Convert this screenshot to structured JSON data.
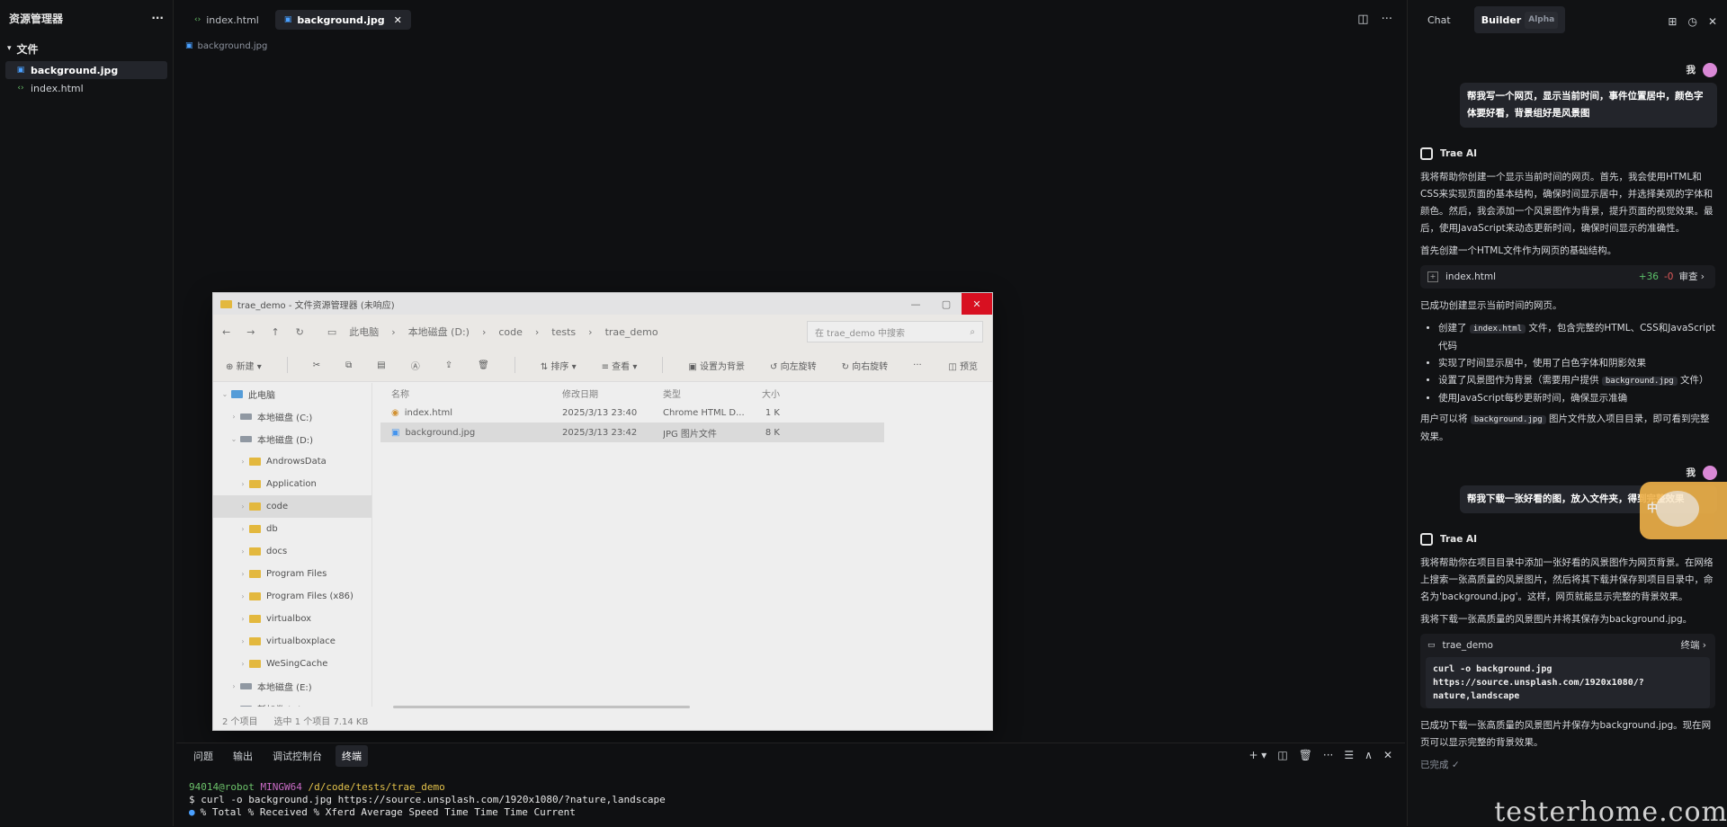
{
  "explorer": {
    "title": "资源管理器",
    "more": "···",
    "section": "文件",
    "files": [
      {
        "name": "background.jpg",
        "icon": "image-icon",
        "active": true
      },
      {
        "name": "index.html",
        "icon": "code-icon",
        "active": false
      }
    ]
  },
  "editor": {
    "tabs": [
      {
        "label": "index.html",
        "active": false
      },
      {
        "label": "background.jpg",
        "active": true
      }
    ],
    "breadcrumb": "background.jpg"
  },
  "winexplorer": {
    "title": "trae_demo - 文件资源管理器 (未响应)",
    "path": [
      "此电脑",
      "本地磁盘 (D:)",
      "code",
      "tests",
      "trae_demo"
    ],
    "search_placeholder": "在 trae_demo 中搜索",
    "toolbar": [
      "新建",
      "排序",
      "查看",
      "设置为背景",
      "向左旋转",
      "向右旋转",
      "···"
    ],
    "preview": "预览",
    "nav": [
      {
        "label": "此电脑",
        "type": "pc",
        "indent": 0,
        "selected": false
      },
      {
        "label": "本地磁盘 (C:)",
        "type": "drive",
        "indent": 1,
        "selected": false
      },
      {
        "label": "本地磁盘 (D:)",
        "type": "drive",
        "indent": 1,
        "selected": false
      },
      {
        "label": "AndrowsData",
        "type": "folder",
        "indent": 2,
        "selected": false
      },
      {
        "label": "Application",
        "type": "folder",
        "indent": 2,
        "selected": false
      },
      {
        "label": "code",
        "type": "folder",
        "indent": 2,
        "selected": true
      },
      {
        "label": "db",
        "type": "folder",
        "indent": 2,
        "selected": false
      },
      {
        "label": "docs",
        "type": "folder",
        "indent": 2,
        "selected": false
      },
      {
        "label": "Program Files",
        "type": "folder",
        "indent": 2,
        "selected": false
      },
      {
        "label": "Program Files (x86)",
        "type": "folder",
        "indent": 2,
        "selected": false
      },
      {
        "label": "virtualbox",
        "type": "folder",
        "indent": 2,
        "selected": false
      },
      {
        "label": "virtualboxplace",
        "type": "folder",
        "indent": 2,
        "selected": false
      },
      {
        "label": "WeSingCache",
        "type": "folder",
        "indent": 2,
        "selected": false
      },
      {
        "label": "本地磁盘 (E:)",
        "type": "drive",
        "indent": 1,
        "selected": false
      },
      {
        "label": "新加卷 (F:)",
        "type": "drive",
        "indent": 1,
        "selected": false
      }
    ],
    "columns": [
      "名称",
      "修改日期",
      "类型",
      "大小"
    ],
    "rows": [
      {
        "name": "index.html",
        "date": "2025/3/13 23:40",
        "type": "Chrome HTML D...",
        "size": "1 K",
        "selected": false
      },
      {
        "name": "background.jpg",
        "date": "2025/3/13 23:42",
        "type": "JPG 图片文件",
        "size": "8 K",
        "selected": true
      }
    ],
    "status": [
      "2 个项目",
      "选中 1 个项目  7.14 KB"
    ]
  },
  "bottom": {
    "tabs": [
      {
        "label": "问题",
        "active": false
      },
      {
        "label": "输出",
        "active": false
      },
      {
        "label": "调试控制台",
        "active": false
      },
      {
        "label": "终端",
        "active": true
      }
    ],
    "terminal": {
      "user": "94014@robot",
      "host": "MINGW64",
      "path": "/d/code/tests/trae_demo",
      "command": "$ curl -o background.jpg https://source.unsplash.com/1920x1080/?nature,landscape",
      "output": "% Total    % Received % Xferd  Average Speed   Time    Time     Time  Current"
    }
  },
  "chat": {
    "tabs": [
      {
        "label": "Chat",
        "active": false
      },
      {
        "label": "Builder",
        "active": true
      }
    ],
    "alpha": "Alpha",
    "user_name": "我",
    "ai_name": "Trae AI",
    "messages": {
      "user1": "帮我写一个网页，显示当前时间，事件位置居中，颜色字体要好看，背景组好是风景图",
      "ai1_p1": "我将帮助你创建一个显示当前时间的网页。首先，我会使用HTML和CSS来实现页面的基本结构，确保时间显示居中，并选择美观的字体和颜色。然后，我会添加一个风景图作为背景，提升页面的视觉效果。最后，使用JavaScript来动态更新时间，确保时间显示的准确性。",
      "ai1_p2": "首先创建一个HTML文件作为网页的基础结构。",
      "file_card": {
        "name": "index.html",
        "added": "+36",
        "removed": "-0",
        "action": "审查 ›"
      },
      "ai1_p3": "已成功创建显示当前时间的网页。",
      "b1_pre": "创建了 ",
      "b1_code": "index.html",
      "b1_post": " 文件，包含完整的HTML、CSS和JavaScript代码",
      "b2": "实现了时间显示居中，使用了白色字体和阴影效果",
      "b3_pre": "设置了风景图作为背景（需要用户提供 ",
      "b3_code": "background.jpg",
      "b3_post": " 文件）",
      "b4": "使用JavaScript每秒更新时间，确保显示准确",
      "ai1_p4_pre": "用户可以将 ",
      "ai1_p4_code": "background.jpg",
      "ai1_p4_post": " 图片文件放入项目目录，即可看到完整效果。",
      "user2": "帮我下载一张好看的图，放入文件夹，得到完整效果",
      "ai2_p1": "我将帮助你在项目目录中添加一张好看的风景图作为网页背景。在网络上搜索一张高质量的风景图片，然后将其下载并保存到项目目录中，命名为'background.jpg'。这样，网页就能显示完整的背景效果。",
      "ai2_p2": "我将下载一张高质量的风景图片并将其保存为background.jpg。",
      "cmd_card": {
        "dir": "trae_demo",
        "action": "终端 ›",
        "command": "curl -o background.jpg https://source.unsplash.com/1920x1080/?nature,landscape"
      },
      "ai2_p3": "已成功下载一张高质量的风景图片并保存为background.jpg。现在网页可以显示完整的背景效果。",
      "done": "已完成 ✓"
    },
    "sticker_text": "中",
    "watermark": "testerhome.com"
  }
}
